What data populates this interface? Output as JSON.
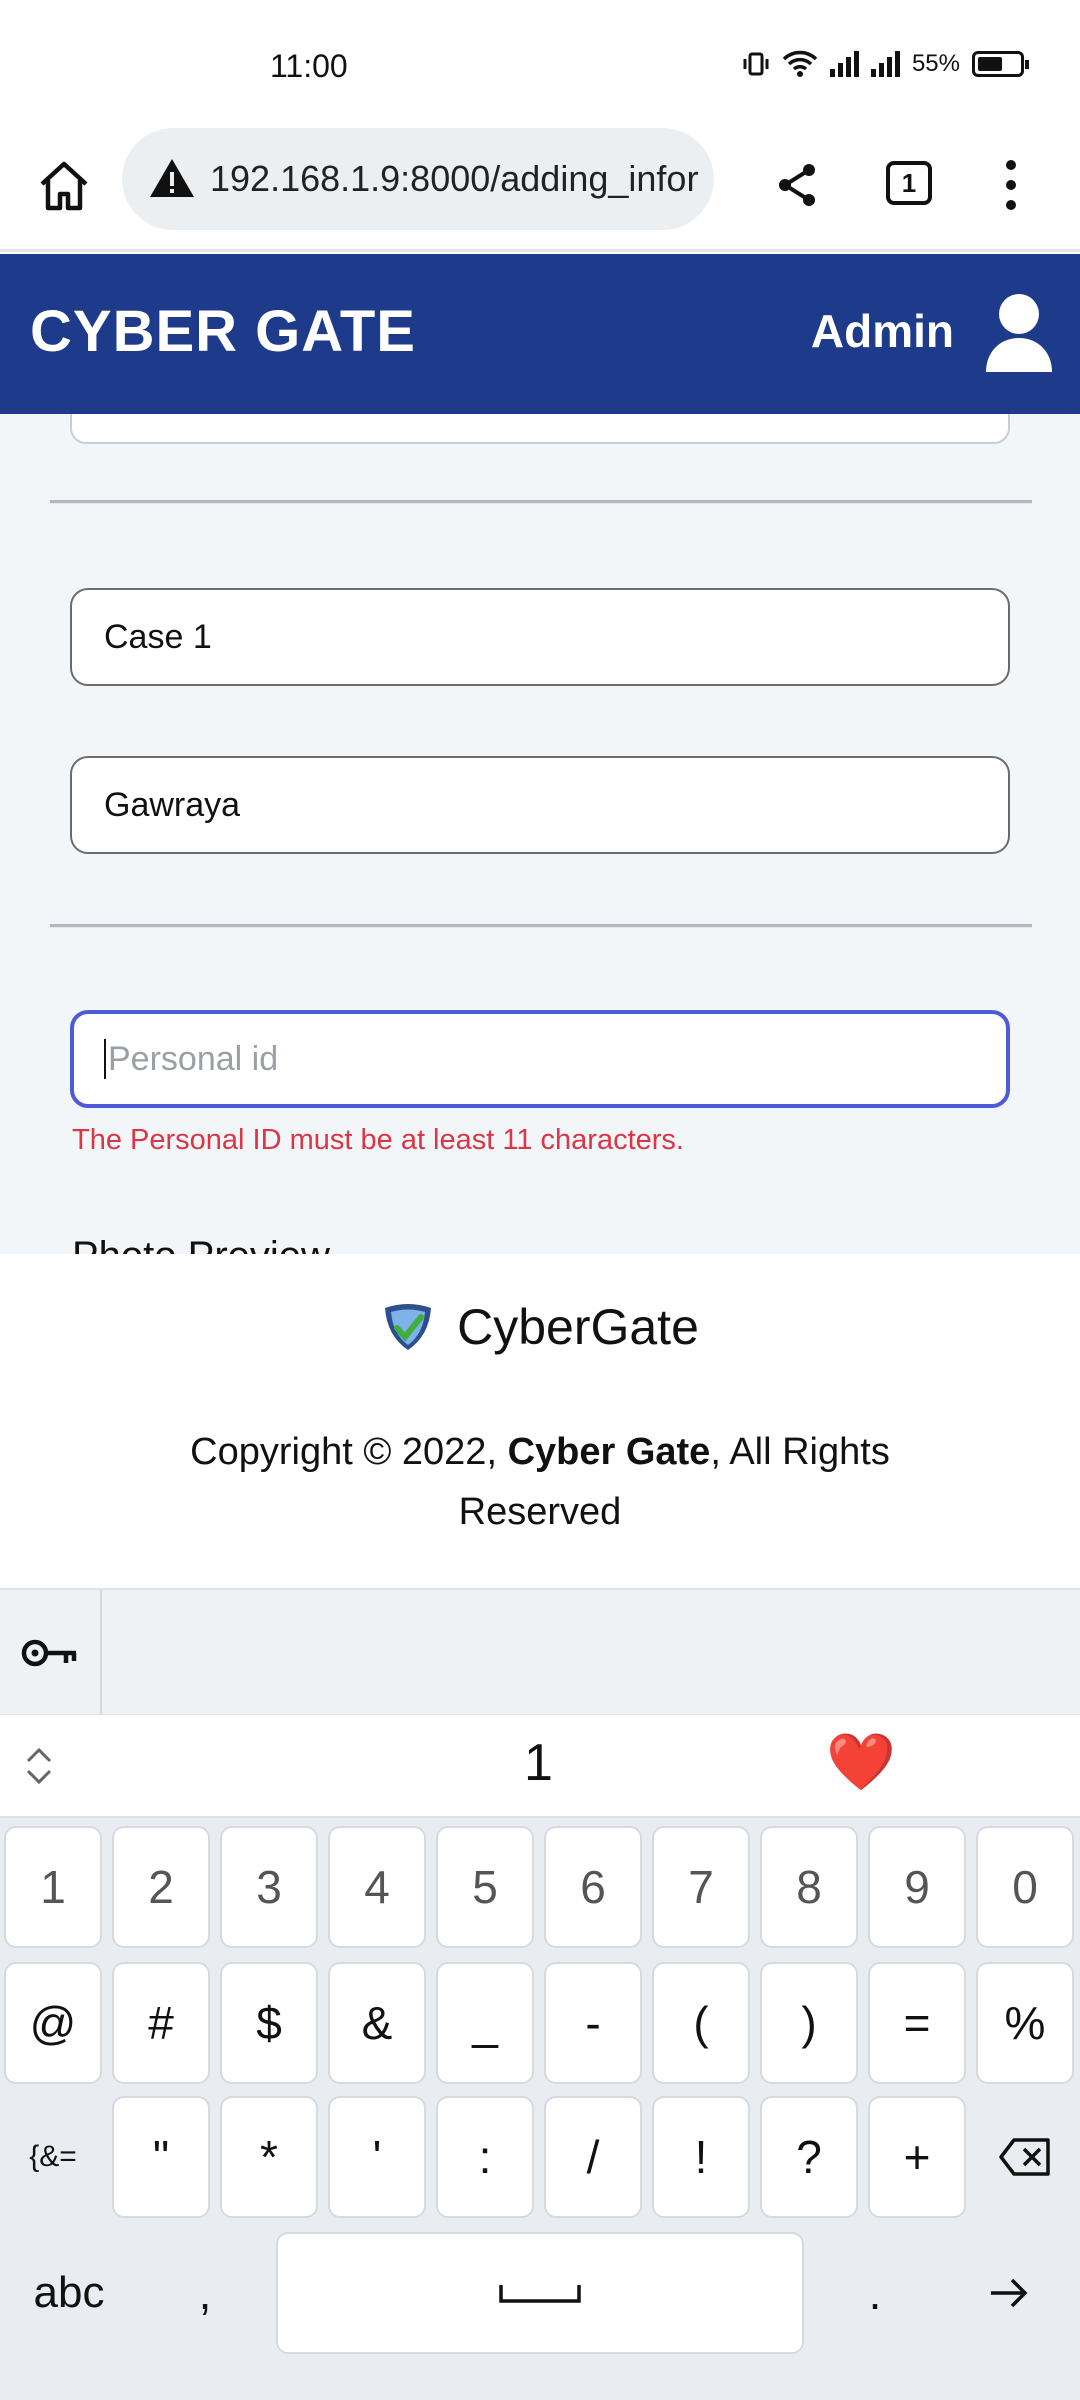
{
  "status_bar": {
    "time": "11:00",
    "battery": "55%"
  },
  "browser": {
    "url": "192.168.1.9:8000/adding_infor",
    "tab_count": "1"
  },
  "header": {
    "brand": "CYBER GATE",
    "admin_label": "Admin"
  },
  "form": {
    "case_value": "Case 1",
    "location_value": "Gawraya",
    "personal_id_placeholder": "Personal id",
    "error_message": "The Personal ID must be at least 11 characters.",
    "photo_preview_label": "Photo Preview"
  },
  "footer": {
    "logo_name": "CyberGate",
    "copyright_prefix": "Copyright © 2022, ",
    "copyright_company": "Cyber Gate",
    "copyright_suffix": ", All Rights Reserved"
  },
  "keyboard": {
    "suggestion_1": "1",
    "suggestion_2": "❤️",
    "row1": [
      "1",
      "2",
      "3",
      "4",
      "5",
      "6",
      "7",
      "8",
      "9",
      "0"
    ],
    "row2": [
      "@",
      "#",
      "$",
      "&",
      "_",
      "-",
      "(",
      ")",
      "=",
      "%"
    ],
    "row3_left": "{&=",
    "row3": [
      "\"",
      "*",
      "'",
      ":",
      "/",
      "!",
      "?",
      "+"
    ],
    "row4_left": "abc",
    "row4_comma": ",",
    "row4_period": "."
  }
}
